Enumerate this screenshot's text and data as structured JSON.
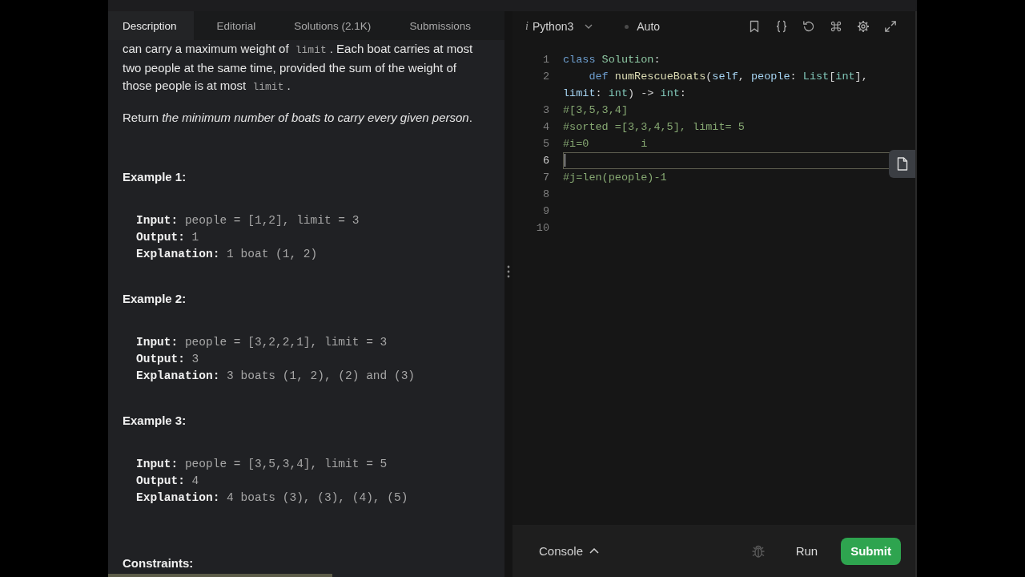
{
  "problem": {
    "tabs": [
      {
        "label": "Description",
        "selected": true
      },
      {
        "label": "Editorial",
        "selected": false
      },
      {
        "label": "Solutions (2.1K)",
        "selected": false
      },
      {
        "label": "Submissions",
        "selected": false
      }
    ],
    "paragraphs": [
      [
        {
          "kind": "text",
          "text": "can carry a maximum weight of "
        },
        {
          "kind": "code",
          "text": "limit"
        },
        {
          "kind": "text",
          "text": ". Each boat carries at most two people at the same time, provided the sum of the weight of those people is at most "
        },
        {
          "kind": "code",
          "text": "limit"
        },
        {
          "kind": "text",
          "text": "."
        }
      ],
      [
        {
          "kind": "text",
          "text": "Return *the minimum number of boats to carry every given person*."
        }
      ]
    ],
    "examples": [
      {
        "title": "Example 1:",
        "lines": [
          {
            "label": "Input:",
            "value": "people = [1,2], limit = 3"
          },
          {
            "label": "Output:",
            "value": "1"
          },
          {
            "label": "Explanation:",
            "value": "1 boat (1, 2)"
          }
        ]
      },
      {
        "title": "Example 2:",
        "lines": [
          {
            "label": "Input:",
            "value": "people = [3,2,2,1], limit = 3"
          },
          {
            "label": "Output:",
            "value": "3"
          },
          {
            "label": "Explanation:",
            "value": "3 boats (1, 2), (2) and (3)"
          }
        ]
      },
      {
        "title": "Example 3:",
        "lines": [
          {
            "label": "Input:",
            "value": "people = [3,5,3,4], limit = 5"
          },
          {
            "label": "Output:",
            "value": "4"
          },
          {
            "label": "Explanation:",
            "value": "4 boats (3), (3), (4), (5)"
          }
        ]
      }
    ],
    "constraints_heading": "Constraints:"
  },
  "editor": {
    "language_icon": "i",
    "language": "Python3",
    "mode": "Auto",
    "lines": [
      {
        "number": "1",
        "current": false,
        "tokens": [
          {
            "kind": "keyword",
            "text": "class"
          },
          {
            "kind": "class",
            "text": " Solution"
          },
          {
            "kind": "plain",
            "text": ":"
          }
        ]
      },
      {
        "number": "2",
        "current": false,
        "tokens": [
          {
            "kind": "keyword",
            "text": "    def"
          },
          {
            "kind": "function",
            "text": " numRescueBoats"
          },
          {
            "kind": "plain",
            "text": "("
          },
          {
            "kind": "param",
            "text": "self"
          },
          {
            "kind": "plain",
            "text": ", "
          },
          {
            "kind": "param",
            "text": "people"
          },
          {
            "kind": "plain",
            "text": ": "
          },
          {
            "kind": "type",
            "text": "List"
          },
          {
            "kind": "plain",
            "text": "["
          },
          {
            "kind": "type",
            "text": "int"
          },
          {
            "kind": "plain",
            "text": "], "
          },
          {
            "kind": "param",
            "text": "limit"
          },
          {
            "kind": "plain",
            "text": ": "
          },
          {
            "kind": "type",
            "text": "int"
          },
          {
            "kind": "plain",
            "text": ") -> "
          },
          {
            "kind": "type",
            "text": "int"
          },
          {
            "kind": "plain",
            "text": ":"
          }
        ]
      },
      {
        "number": "3",
        "current": false,
        "tokens": [
          {
            "kind": "comment",
            "text": "#[3,5,3,4]"
          }
        ]
      },
      {
        "number": "4",
        "current": false,
        "tokens": [
          {
            "kind": "comment",
            "text": "#sorted =[3,3,4,5], limit= 5"
          }
        ]
      },
      {
        "number": "5",
        "current": false,
        "tokens": [
          {
            "kind": "comment",
            "text": "#i=0        i"
          }
        ]
      },
      {
        "number": "6",
        "current": true
      },
      {
        "number": "7",
        "current": false,
        "tokens": [
          {
            "kind": "comment",
            "text": "#j=len(people)-1"
          }
        ]
      },
      {
        "number": "8",
        "current": false
      },
      {
        "number": "9",
        "current": false
      },
      {
        "number": "10",
        "current": false
      }
    ]
  },
  "action_bar": {
    "console": "Console",
    "run": "Run",
    "submit": "Submit"
  }
}
